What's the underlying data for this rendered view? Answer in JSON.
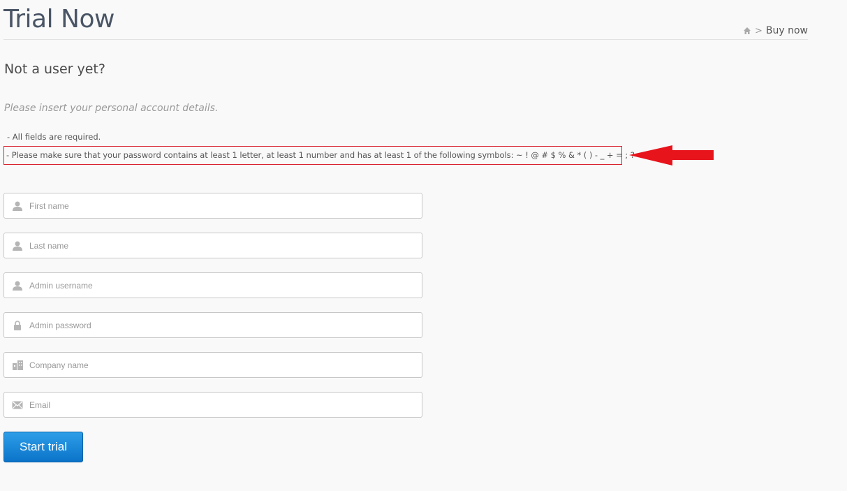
{
  "header": {
    "title": "Trial Now",
    "breadcrumb": {
      "separator": ">",
      "current": "Buy now"
    }
  },
  "subtitle": "Not a user yet?",
  "instruction": "Please insert your personal account details.",
  "notes": {
    "required": "-  All fields are required.",
    "password": "-  Please make sure that your password contains at least 1 letter, at least 1 number and has at least 1 of the following symbols: ~ ! @ # $ % & * ( ) - _ + = ; ? < > :"
  },
  "form": {
    "first_name": {
      "placeholder": "First name",
      "icon": "user-icon"
    },
    "last_name": {
      "placeholder": "Last name",
      "icon": "user-icon"
    },
    "admin_username": {
      "placeholder": "Admin username",
      "icon": "user-icon"
    },
    "admin_password": {
      "placeholder": "Admin password",
      "icon": "lock-icon"
    },
    "company_name": {
      "placeholder": "Company name",
      "icon": "building-icon"
    },
    "email": {
      "placeholder": "Email",
      "icon": "envelope-icon"
    },
    "submit_label": "Start trial"
  },
  "colors": {
    "highlight_border": "#d9232e",
    "arrow": "#e8141c",
    "button": "#1a86d6"
  }
}
